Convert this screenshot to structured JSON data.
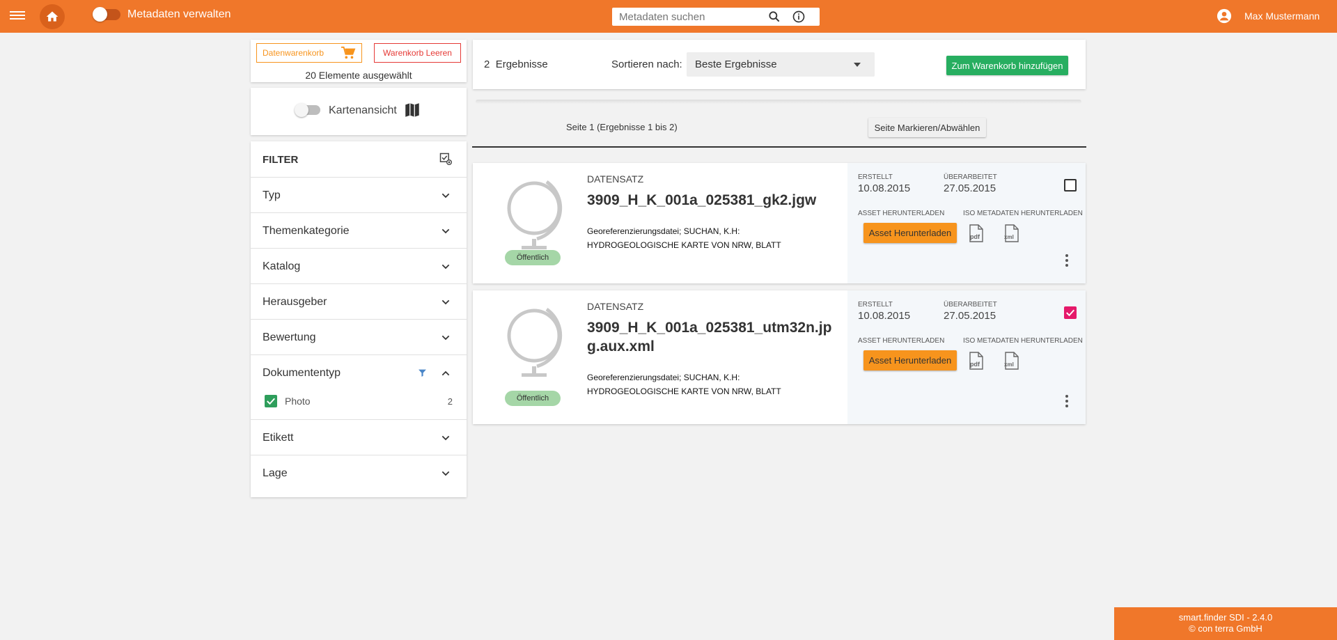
{
  "header": {
    "title": "Metadaten verwalten",
    "search_placeholder": "Metadaten suchen",
    "user_name": "Max Mustermann",
    "accent_color": "#f0772a"
  },
  "cart": {
    "cart_label": "Datenwarenkorb",
    "clear_label": "Warenkorb Leeren",
    "selected_text": "20 Elemente ausgewählt"
  },
  "map_view": {
    "label": "Kartenansicht",
    "enabled": false
  },
  "filter": {
    "title": "FILTER",
    "items": [
      {
        "label": "Typ"
      },
      {
        "label": "Themenkategorie"
      },
      {
        "label": "Katalog"
      },
      {
        "label": "Herausgeber"
      },
      {
        "label": "Bewertung"
      },
      {
        "label": "Dokumententyp",
        "expanded": true,
        "options": [
          {
            "label": "Photo",
            "count": "2",
            "checked": true
          }
        ]
      },
      {
        "label": "Etikett"
      },
      {
        "label": "Lage"
      }
    ]
  },
  "results": {
    "count": "2",
    "count_label": "Ergebnisse",
    "sort_label": "Sortieren nach:",
    "sort_value": "Beste Ergebnisse",
    "add_to_cart_label": "Zum Warenkorb hinzufügen",
    "pager_text": "Seite 1 (Ergebnisse 1 bis 2)",
    "mark_page_label": "Seite Markieren/Abwählen",
    "records": [
      {
        "type": "DATENSATZ",
        "title": "3909_H_K_001a_025381_gk2.jgw",
        "description": "Georeferenzierungsdatei; SUCHAN, K.H: HYDROGEOLOGISCHE KARTE VON NRW, BLATT",
        "badge": "Öffentlich",
        "created_label": "ERSTELLT",
        "created": "10.08.2015",
        "revised_label": "ÜBERARBEITET",
        "revised": "27.05.2015",
        "asset_label": "ASSET HERUNTERLADEN",
        "iso_label": "ISO METADATEN HERUNTERLADEN",
        "asset_button": "Asset Herunterladen",
        "pdf_icon": "pdf-file-icon",
        "xml_icon": "xml-file-icon",
        "selected": false
      },
      {
        "type": "DATENSATZ",
        "title": "3909_H_K_001a_025381_utm32n.jpg.aux.xml",
        "description": "Georeferenzierungsdatei; SUCHAN, K.H: HYDROGEOLOGISCHE KARTE VON NRW, BLATT",
        "badge": "Öffentlich",
        "created_label": "ERSTELLT",
        "created": "10.08.2015",
        "revised_label": "ÜBERARBEITET",
        "revised": "27.05.2015",
        "asset_label": "ASSET HERUNTERLADEN",
        "iso_label": "ISO METADATEN HERUNTERLADEN",
        "asset_button": "Asset Herunterladen",
        "pdf_icon": "pdf-file-icon",
        "xml_icon": "xml-file-icon",
        "selected": true
      }
    ]
  },
  "footer": {
    "line1": "smart.finder SDI - 2.4.0",
    "line2": "© con terra GmbH"
  }
}
